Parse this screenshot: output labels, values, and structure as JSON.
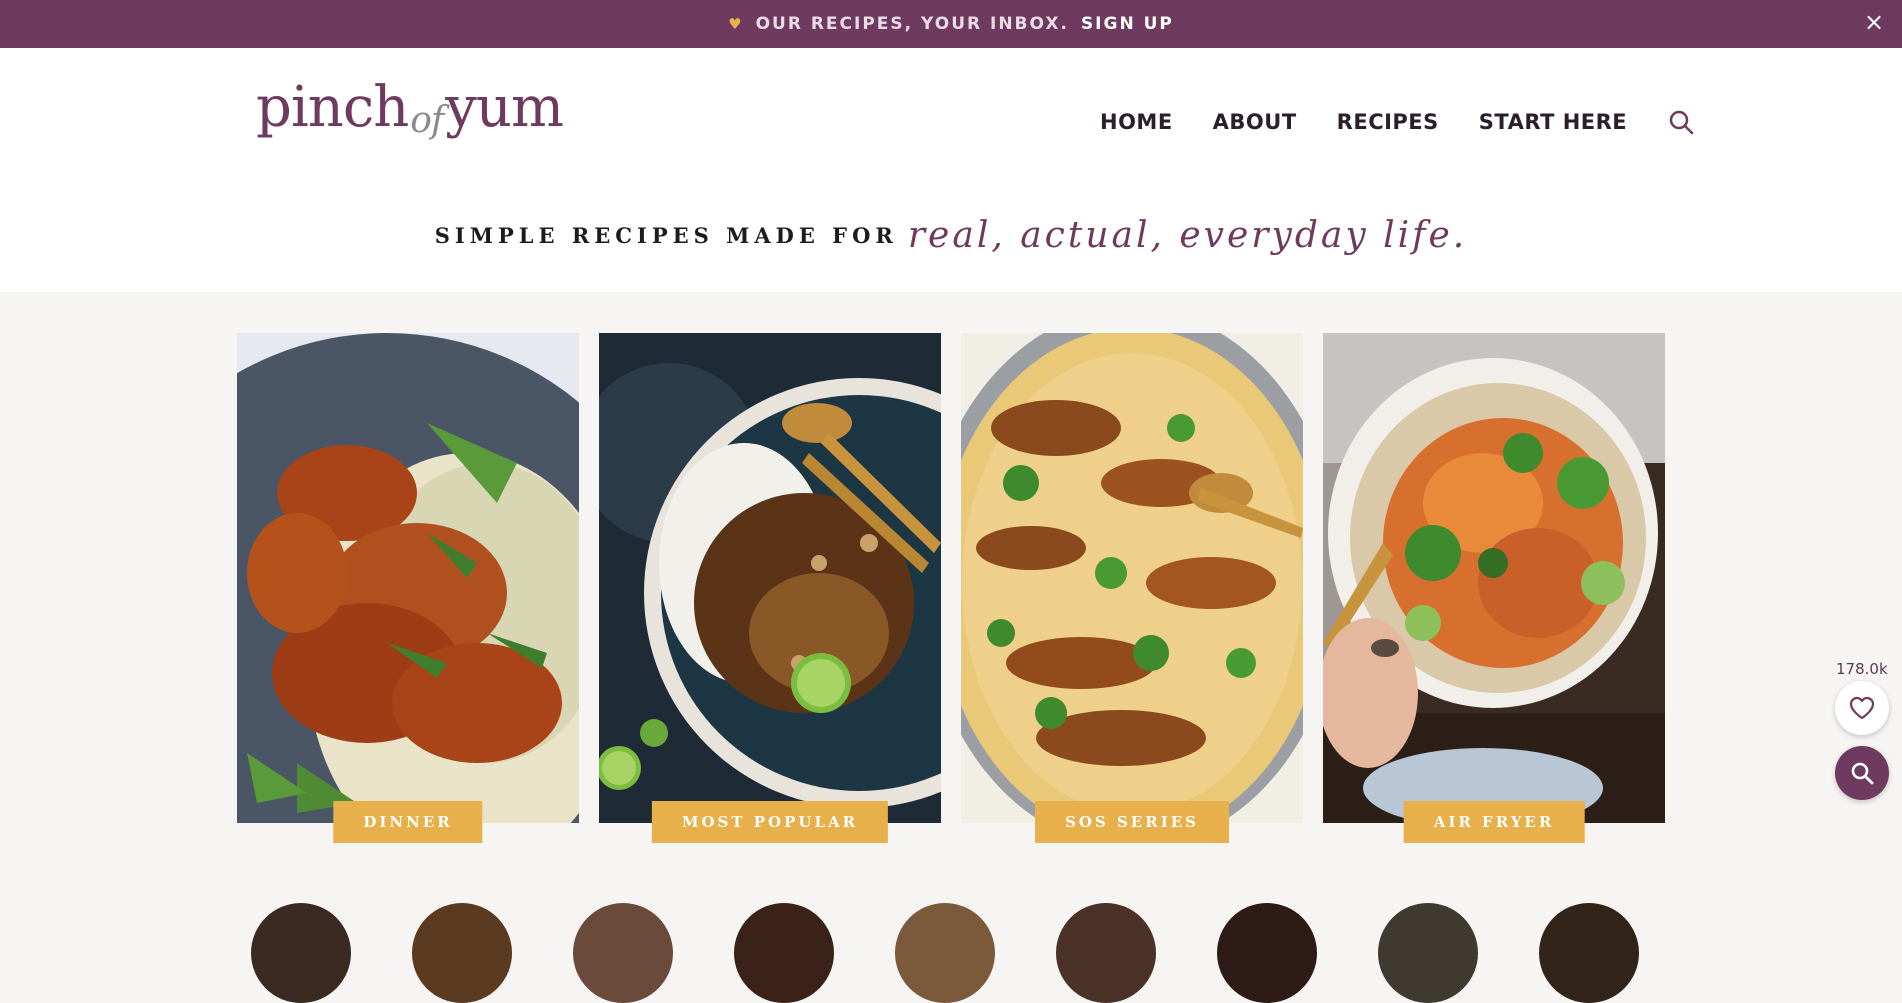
{
  "banner": {
    "promo_text": "OUR RECIPES, YOUR INBOX.",
    "signup_label": "SIGN UP",
    "close_label": "×"
  },
  "header": {
    "logo_part1": "pinch",
    "logo_part2": "of",
    "logo_part3": "yum",
    "nav": [
      "HOME",
      "ABOUT",
      "RECIPES",
      "START HERE"
    ]
  },
  "tagline": {
    "lead": "SIMPLE RECIPES MADE FOR",
    "script": "real, actual, everyday life."
  },
  "categories": [
    {
      "label": "DINNER",
      "photo": "crispy-glazed-chicken-cutlet-photo"
    },
    {
      "label": "MOST POPULAR",
      "photo": "basil-chicken-rice-bowl-photo"
    },
    {
      "label": "SOS SERIES",
      "photo": "creamy-chicken-skillet-photo"
    },
    {
      "label": "AIR FRYER",
      "photo": "crispy-rice-salad-bowl-photo"
    }
  ],
  "floating": {
    "favorites_count": "178.0k"
  },
  "colors": {
    "brand_plum": "#6f3a5f",
    "accent_gold": "#e8b04a",
    "page_bg": "#f6f5f4"
  }
}
